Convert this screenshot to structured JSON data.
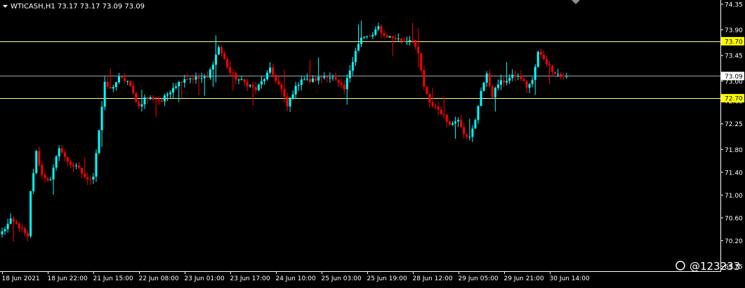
{
  "header": {
    "symbol_label": "WTICASH,H1",
    "ohlc_text": "73.17 73.17 73.09 73.09"
  },
  "watermark": "@123233",
  "colors": {
    "background": "#000000",
    "up": "#00FFFF",
    "down": "#FF0000",
    "axis": "#FFFFFF",
    "level_line": "#FFFF80",
    "level_badge": "#FFFF00",
    "price_line": "#9AA8B0",
    "price_badge": "#FFFFFF"
  },
  "chart_data": {
    "type": "candlestick",
    "timeframe": "H1",
    "ylim": [
      69.75,
      74.35
    ],
    "y_ticks": [
      "74.35",
      "73.90",
      "73.45",
      "73.00",
      "72.65",
      "72.25",
      "71.80",
      "71.40",
      "71.00",
      "70.60",
      "70.20",
      "69.75"
    ],
    "y_tick_values": [
      74.35,
      73.9,
      73.45,
      73.0,
      72.65,
      72.25,
      71.8,
      71.4,
      71.0,
      70.6,
      70.2,
      69.75
    ],
    "x_ticks": [
      "18 Jun 2021",
      "18 Jun 22:00",
      "21 Jun 15:00",
      "22 Jun 08:00",
      "23 Jun 01:00",
      "23 Jun 17:00",
      "24 Jun 10:00",
      "25 Jun 03:00",
      "25 Jun 19:00",
      "28 Jun 12:00",
      "29 Jun 05:00",
      "29 Jun 21:00",
      "30 Jun 14:00"
    ],
    "x_tick_bars": [
      0,
      16,
      32,
      48,
      64,
      80,
      96,
      112,
      128,
      144,
      160,
      176,
      192
    ],
    "horizontal_levels": [
      {
        "label": "73.70",
        "value": 73.7
      },
      {
        "label": "72.70",
        "value": 72.7
      }
    ],
    "current_price": {
      "label": "73.09",
      "value": 73.09
    },
    "waypoints": [
      [
        0,
        70.35
      ],
      [
        3,
        70.55
      ],
      [
        6,
        70.45
      ],
      [
        9,
        70.25
      ],
      [
        10,
        71.05
      ],
      [
        12,
        71.75
      ],
      [
        14,
        71.35
      ],
      [
        17,
        71.25
      ],
      [
        20,
        71.85
      ],
      [
        22,
        71.65
      ],
      [
        24,
        71.55
      ],
      [
        27,
        71.45
      ],
      [
        30,
        71.25
      ],
      [
        32,
        71.35
      ],
      [
        34,
        72.15
      ],
      [
        36,
        72.95
      ],
      [
        38,
        72.85
      ],
      [
        41,
        73.05
      ],
      [
        44,
        73.0
      ],
      [
        48,
        72.55
      ],
      [
        50,
        72.7
      ],
      [
        53,
        72.7
      ],
      [
        56,
        72.65
      ],
      [
        60,
        72.9
      ],
      [
        64,
        73.05
      ],
      [
        68,
        73.05
      ],
      [
        72,
        73.05
      ],
      [
        76,
        73.6
      ],
      [
        80,
        73.15
      ],
      [
        82,
        73.05
      ],
      [
        86,
        72.95
      ],
      [
        89,
        72.85
      ],
      [
        92,
        73.05
      ],
      [
        94,
        73.2
      ],
      [
        98,
        72.85
      ],
      [
        100,
        72.55
      ],
      [
        102,
        72.8
      ],
      [
        105,
        73.05
      ],
      [
        108,
        73.0
      ],
      [
        111,
        73.05
      ],
      [
        114,
        73.1
      ],
      [
        116,
        73.05
      ],
      [
        118,
        72.95
      ],
      [
        120,
        72.85
      ],
      [
        122,
        73.2
      ],
      [
        124,
        73.55
      ],
      [
        126,
        73.75
      ],
      [
        130,
        73.8
      ],
      [
        132,
        73.95
      ],
      [
        134,
        73.8
      ],
      [
        138,
        73.75
      ],
      [
        141,
        73.7
      ],
      [
        144,
        73.75
      ],
      [
        146,
        73.45
      ],
      [
        148,
        72.9
      ],
      [
        150,
        72.6
      ],
      [
        152,
        72.55
      ],
      [
        154,
        72.45
      ],
      [
        156,
        72.3
      ],
      [
        158,
        72.25
      ],
      [
        160,
        72.35
      ],
      [
        162,
        72.1
      ],
      [
        164,
        72.0
      ],
      [
        166,
        72.3
      ],
      [
        168,
        72.85
      ],
      [
        170,
        73.1
      ],
      [
        172,
        72.75
      ],
      [
        174,
        72.95
      ],
      [
        176,
        73.0
      ],
      [
        178,
        73.05
      ],
      [
        180,
        73.1
      ],
      [
        182,
        73.05
      ],
      [
        184,
        72.9
      ],
      [
        186,
        73.0
      ],
      [
        188,
        73.5
      ],
      [
        190,
        73.4
      ],
      [
        192,
        73.25
      ],
      [
        194,
        73.15
      ],
      [
        196,
        73.1
      ],
      [
        198,
        73.09
      ]
    ]
  }
}
